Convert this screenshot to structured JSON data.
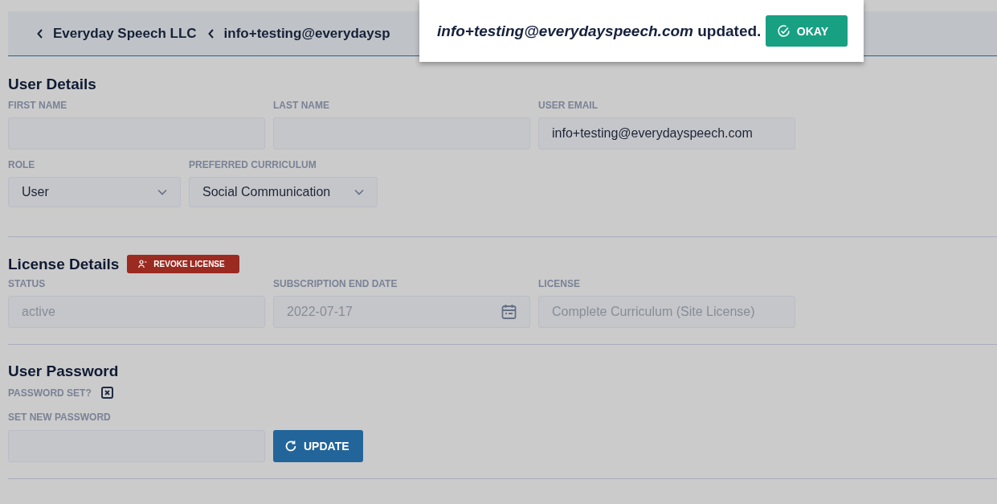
{
  "breadcrumbs": [
    {
      "label": "Everyday Speech LLC"
    },
    {
      "label": "info+testing@everydaysp"
    }
  ],
  "toast": {
    "message": "*info+testing@everydayspeech.com* updated.",
    "button": "OKAY"
  },
  "user_details": {
    "title": "User Details",
    "fields": [
      {
        "kind": "text",
        "label": "FIRST NAME"
      },
      {
        "kind": "text",
        "label": "LAST NAME"
      },
      {
        "kind": "text",
        "label": "USER EMAIL",
        "value": "info+testing@everydayspeech.com"
      }
    ],
    "selects": [
      {
        "label": "ROLE",
        "value": "User"
      },
      {
        "label": "PREFERRED CURRICULUM",
        "value": "Social Communication"
      }
    ]
  },
  "license_details": {
    "title": "License Details",
    "revoke_button": "REVOKE LICENSE",
    "fields": [
      {
        "kind": "text",
        "label": "STATUS",
        "value": "active",
        "disabled": true
      },
      {
        "kind": "date",
        "label": "SUBSCRIPTION END DATE",
        "value": "2022-07-17",
        "disabled": true
      },
      {
        "kind": "text",
        "label": "LICENSE",
        "value": "Complete Curriculum (Site License)",
        "disabled": true
      }
    ]
  },
  "user_password": {
    "title": "User Password",
    "password_set_label": "PASSWORD SET?",
    "password_set_mark": {
      "kind": "cross"
    },
    "new_password_label": "SET NEW PASSWORD",
    "update_button": "UPDATE"
  }
}
